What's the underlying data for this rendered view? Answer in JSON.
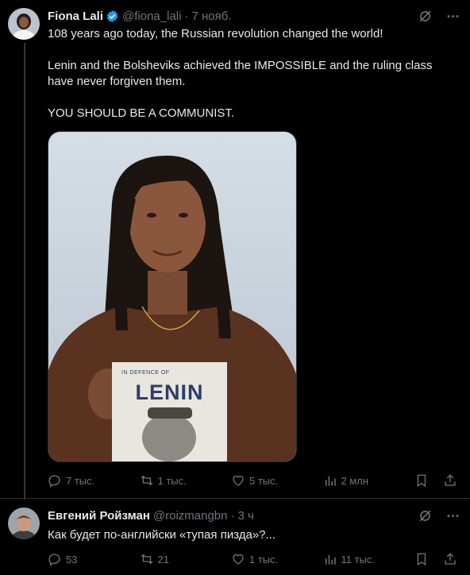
{
  "post1": {
    "author_name": "Fiona Lali",
    "handle": "@fiona_lali",
    "dot": "·",
    "time": "7 нояб.",
    "paragraphs": [
      "108 years ago today, the Russian revolution changed the world!",
      "Lenin and the Bolsheviks achieved the IMPOSSIBLE and the ruling class have never forgiven them.",
      "YOU SHOULD BE A COMMUNIST."
    ],
    "book": {
      "subtitle": "IN DEFENCE OF",
      "title": "LENIN"
    },
    "stats": {
      "replies": "7 тыс.",
      "reposts": "1 тыс.",
      "likes": "5 тыс.",
      "views": "2 млн"
    }
  },
  "post2": {
    "author_name": "Евгений Ройзман",
    "handle": "@roizmangbn",
    "dot": "·",
    "time": "3 ч",
    "text": "Как будет по-английски «тупая пизда»?...",
    "stats": {
      "replies": "53",
      "reposts": "21",
      "likes": "1 тыс.",
      "views": "11 тыс."
    }
  },
  "colors": {
    "background": "#000000",
    "text": "#e7e9ea",
    "muted": "#71767b",
    "verified": "#1d9bf0",
    "divider": "#2f3336"
  },
  "icons": [
    "verified-badge-icon",
    "grok-icon",
    "more-icon",
    "reply-icon",
    "repost-icon",
    "like-icon",
    "views-icon",
    "bookmark-icon",
    "share-icon"
  ]
}
